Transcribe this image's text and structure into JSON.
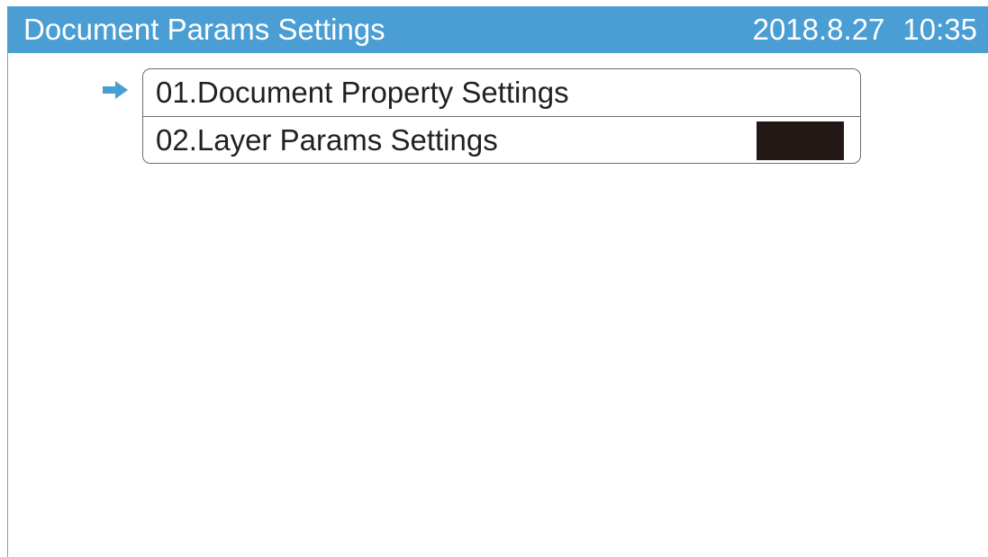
{
  "header": {
    "title": "Document Params Settings",
    "date": "2018.8.27",
    "time": "10:35",
    "background_color": "#4a9ed3",
    "text_color": "#ffffff"
  },
  "menu": {
    "selected_index": 0,
    "pointer_icon": "arrow-right-icon",
    "pointer_color": "#4a9ed3",
    "items": [
      {
        "label": "01.Document Property Settings"
      },
      {
        "label": "02.Layer Params Settings"
      }
    ]
  }
}
